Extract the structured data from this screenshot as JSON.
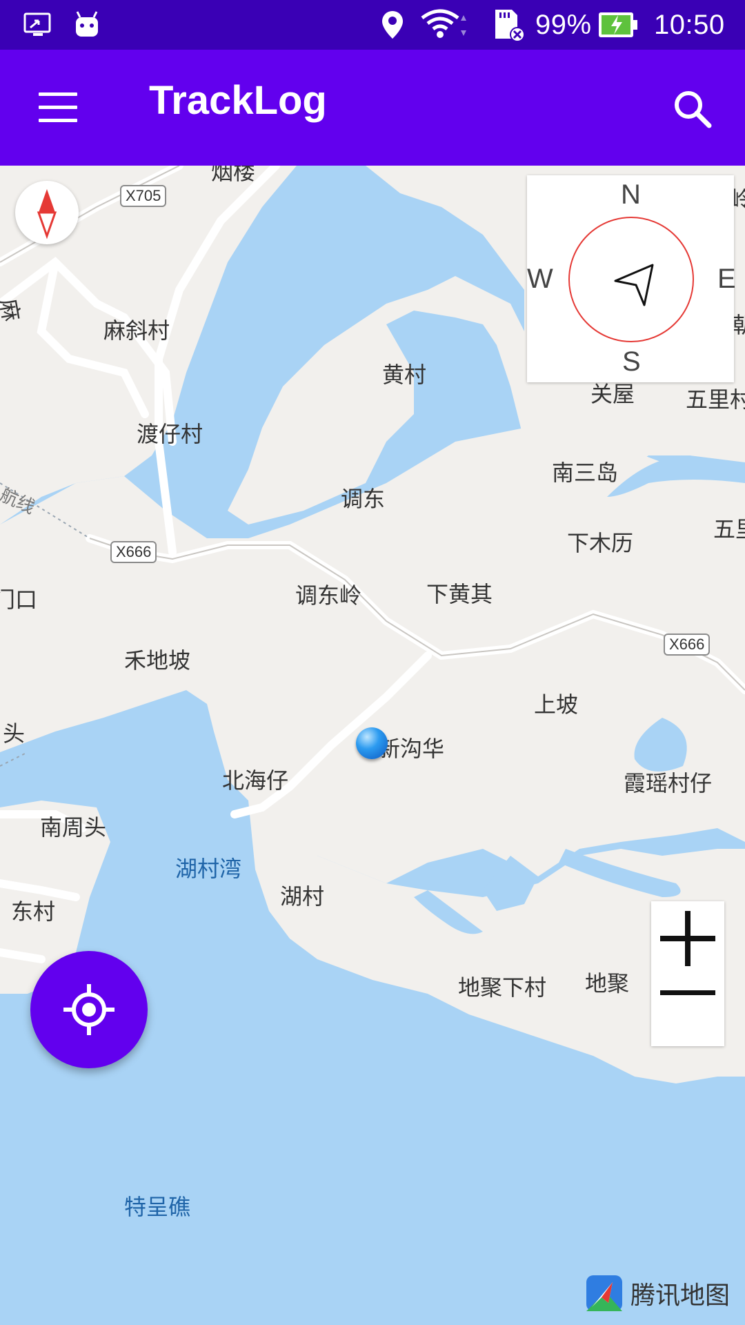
{
  "status_bar": {
    "battery_percent": "99%",
    "time": "10:50"
  },
  "app_bar": {
    "title": "TrackLog"
  },
  "map": {
    "labels": {
      "yanlou": "烟楼",
      "mashecun": "麻斜村",
      "huangcun": "黄村",
      "duzaicun": "渡仔村",
      "tiaodong": "调东",
      "nansandao": "南三岛",
      "xiamuli": "下木历",
      "tiaodongling": "调东岭",
      "xiahuangqi": "下黄其",
      "hedipo": "禾地坡",
      "shangpo": "上坡",
      "xingouhua": "新沟华",
      "beihaizai": "北海仔",
      "xiayaocunzai": "霞瑶村仔",
      "nanzhoutou": "南周头",
      "hucunwan": "湖村湾",
      "hucun": "湖村",
      "dongcun": "东村",
      "dijuxiacun": "地聚下村",
      "diju": "地聚",
      "techengjiao": "特呈礁",
      "guanwu": "关屋",
      "wulicun": "五里村",
      "wuli": "五里",
      "menkou": "门口",
      "tou": "头",
      "ma": "麻",
      "hangxian": "航线",
      "edge_top_right": "岭",
      "edge_right": "朝"
    },
    "route_shields": {
      "x705": "X705",
      "x666_left": "X666",
      "x666_right": "X666"
    },
    "compass": {
      "north": "N",
      "south": "S",
      "east": "E",
      "west": "W"
    },
    "logo_text": "腾讯地图"
  },
  "colors": {
    "status_bar": "#3a00b5",
    "app_bar": "#6200ee",
    "water": "#a9d3f5",
    "land": "#f2f0ed",
    "fab": "#6200ee"
  },
  "icons": {
    "menu": "hamburger-menu-icon",
    "search": "search-icon",
    "compass": "compass-icon",
    "zoom_in": "plus-icon",
    "zoom_out": "minus-icon",
    "my_location": "my-location-icon"
  }
}
